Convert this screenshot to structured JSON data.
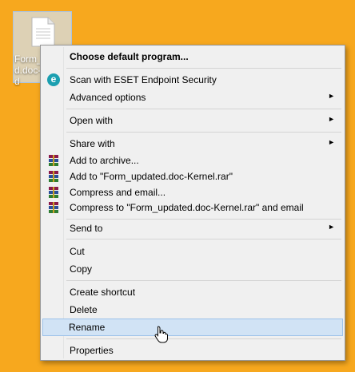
{
  "desktop": {
    "file_icon_label": "Form_u\nd.doc-\nd"
  },
  "context_menu": {
    "items": [
      {
        "label": "Choose default program...",
        "bold": true
      },
      {
        "label": "Scan with ESET Endpoint Security",
        "icon": "eset-icon"
      },
      {
        "label": "Advanced options",
        "submenu": true
      },
      {
        "label": "Open with",
        "submenu": true
      },
      {
        "label": "Share with",
        "submenu": true
      },
      {
        "label": "Add to archive...",
        "icon": "winrar-icon"
      },
      {
        "label": "Add to \"Form_updated.doc-Kernel.rar\"",
        "icon": "winrar-icon"
      },
      {
        "label": "Compress and email...",
        "icon": "winrar-icon"
      },
      {
        "label": "Compress to \"Form_updated.doc-Kernel.rar\" and email",
        "icon": "winrar-icon"
      },
      {
        "label": "Send to",
        "submenu": true
      },
      {
        "label": "Cut"
      },
      {
        "label": "Copy"
      },
      {
        "label": "Create shortcut"
      },
      {
        "label": "Delete"
      },
      {
        "label": "Rename",
        "highlighted": true
      },
      {
        "label": "Properties"
      }
    ],
    "submenu_arrow": "►",
    "eset_glyph": "e",
    "highlight_color": "#d1e3f5",
    "background_color": "#f0f0f0"
  },
  "desktop_background_color": "#f7a81e"
}
